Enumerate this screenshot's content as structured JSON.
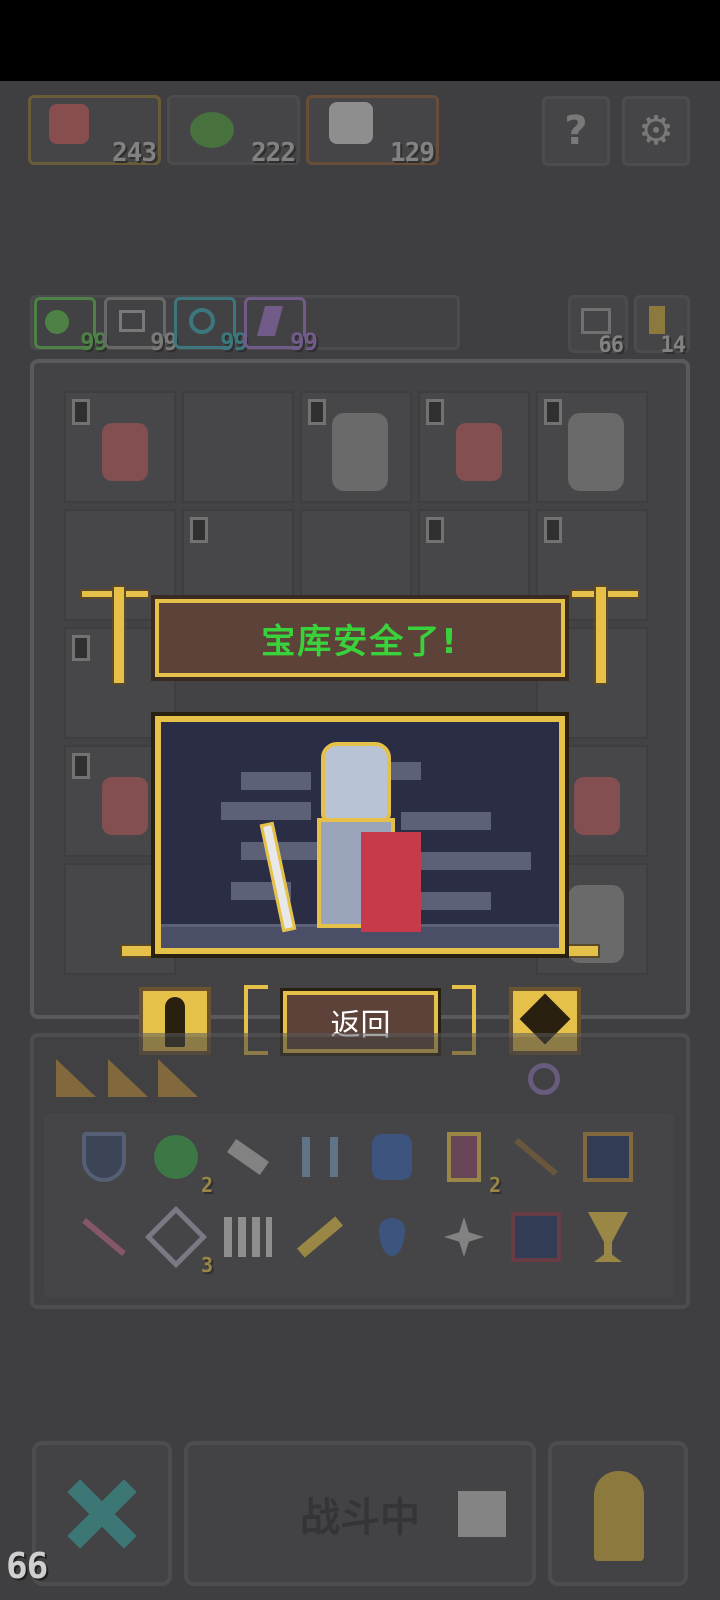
{
  "top_bar": {
    "characters": [
      {
        "name": "girl-red-hair",
        "count": "243"
      },
      {
        "name": "green-slime",
        "count": "222"
      },
      {
        "name": "white-hair-mage",
        "count": "129"
      }
    ],
    "help_label": "?",
    "settings_label": "⚙"
  },
  "resources": {
    "items": [
      {
        "icon": "green-orb-icon",
        "value": "99",
        "color": "#5ab84a"
      },
      {
        "icon": "scissors-icon",
        "value": "99",
        "color": "#a9a9a9"
      },
      {
        "icon": "spiral-icon",
        "value": "99",
        "color": "#3aa6b0"
      },
      {
        "icon": "lightning-icon",
        "value": "99",
        "color": "#9a72c4"
      }
    ],
    "swap_count": "66",
    "pawn_count": "14"
  },
  "dialog": {
    "title": "宝库安全了!",
    "return_label": "返回"
  },
  "inventory": {
    "row1": [
      "shield-icon",
      "green-gem-icon",
      "hammer-icon",
      "claw-icon",
      "potion-jar-icon",
      "scroll-icon",
      "arrow-icon",
      "blue-flame-tile-icon"
    ],
    "row1_counts": [
      "",
      "2",
      "",
      "",
      "",
      "2",
      "",
      ""
    ],
    "row2": [
      "arrow-red-icon",
      "crossed-swords-icon",
      "spikes-icon",
      "key-icon",
      "water-drop-icon",
      "shuriken-icon",
      "blue-flame-tile-icon",
      "goblet-icon"
    ],
    "row2_counts": [
      "",
      "3",
      "",
      "",
      "",
      "",
      "",
      ""
    ]
  },
  "bottom": {
    "battle_label": "战斗中",
    "counter": "66"
  },
  "colors": {
    "gold": "#e6c14a",
    "title_green": "#39d23b",
    "panel_brown": "#5c4238"
  }
}
